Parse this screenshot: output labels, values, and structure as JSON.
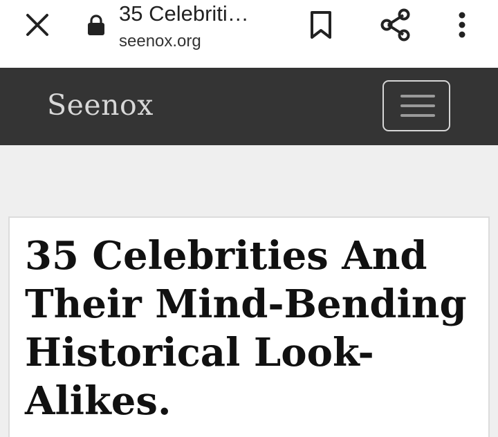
{
  "browser_toolbar": {
    "title": "35 Celebriti…",
    "domain": "seenox.org",
    "icons": {
      "close": "close-icon",
      "lock": "lock-icon",
      "bookmark": "bookmark-icon",
      "share": "share-icon",
      "more": "more-vertical-icon"
    }
  },
  "navbar": {
    "brand": "Seenox",
    "menu_icon": "hamburger-menu-icon"
  },
  "article": {
    "headline": "35 Celebrities And Their Mind-Bending Historical Look-Alikes."
  },
  "colors": {
    "toolbar_bg": "#ffffff",
    "navbar_bg": "#343434",
    "page_bg": "#efefef",
    "card_bg": "#ffffff",
    "headline_text": "#111111"
  }
}
